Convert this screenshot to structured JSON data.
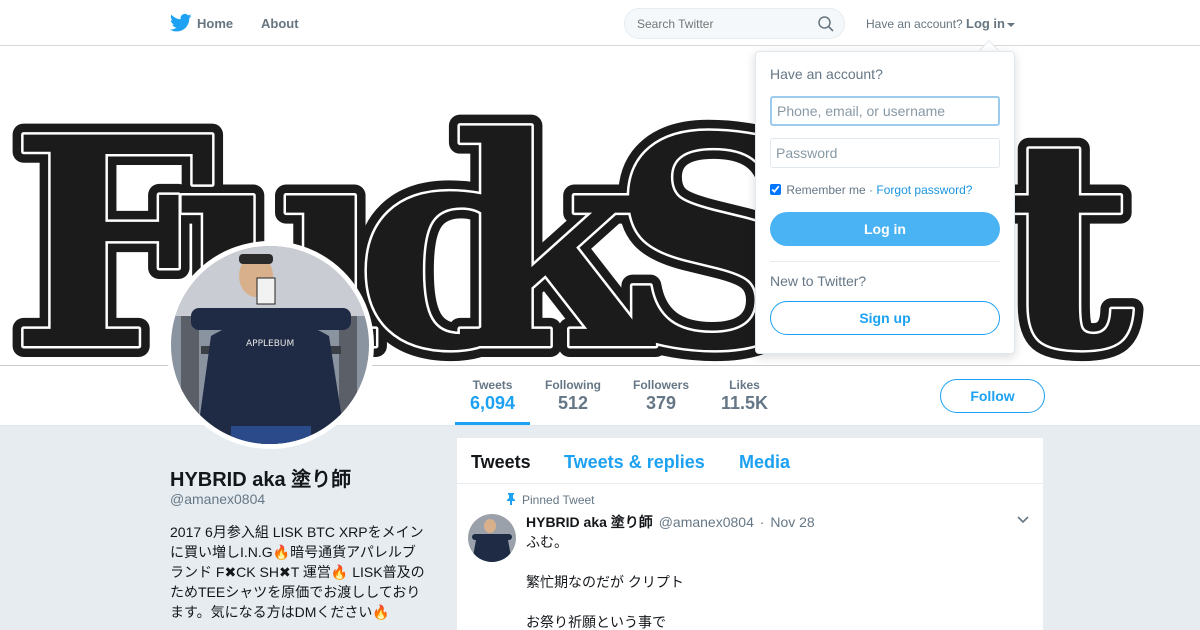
{
  "nav": {
    "home_label": "Home",
    "about_label": "About",
    "search_placeholder": "Search Twitter",
    "have_account": "Have an account?",
    "login_label": "Log in"
  },
  "profile": {
    "name": "HYBRID aka 塗り師",
    "handle": "@amanex0804",
    "bio_lines": [
      "2017 6月参入組 LISK BTC XRPをメイン",
      "に買い増しI.N.G",
      "暗号通貨アパレルブ",
      "ランド F✖CK SH✖T 運営",
      "LISK普及の",
      "ためTEEシャツを原価でお渡ししており",
      "ます。気になる方はDMください"
    ],
    "fire_emoji": "🔥",
    "follow_label": "Follow"
  },
  "stats": [
    {
      "label": "Tweets",
      "value": "6,094"
    },
    {
      "label": "Following",
      "value": "512"
    },
    {
      "label": "Followers",
      "value": "379"
    },
    {
      "label": "Likes",
      "value": "11.5K"
    }
  ],
  "timeline": {
    "tabs": [
      "Tweets",
      "Tweets & replies",
      "Media"
    ],
    "pinned_label": "Pinned Tweet",
    "tweet": {
      "name": "HYBRID aka 塗り師",
      "handle": "@amanex0804",
      "date": "Nov 28",
      "lines": [
        "ふむ。",
        "繁忙期なのだが クリプト",
        "お祭り祈願という事で"
      ]
    }
  },
  "login_dropdown": {
    "title": "Have an account?",
    "user_placeholder": "Phone, email, or username",
    "password_placeholder": "Password",
    "remember_label": "Remember me",
    "separator": "·",
    "forgot_label": "Forgot password?",
    "login_button": "Log in",
    "new_label": "New to Twitter?",
    "signup_button": "Sign up"
  },
  "colors": {
    "accent": "#1da1f2",
    "login_button": "#4ab3f4",
    "background": "#e6ecf0"
  }
}
